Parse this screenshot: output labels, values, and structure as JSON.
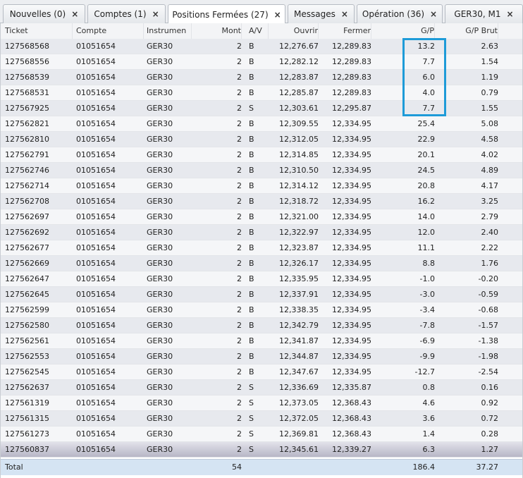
{
  "tabs": [
    {
      "label": "Nouvelles (0)",
      "active": false
    },
    {
      "label": "Comptes (1)",
      "active": false
    },
    {
      "label": "Positions Fermées (27)",
      "active": true
    },
    {
      "label": "Messages",
      "active": false
    },
    {
      "label": "Opération (36)",
      "active": false
    },
    {
      "label": "GER30, M1",
      "active": false
    }
  ],
  "close_icon": "×",
  "columns": {
    "ticket": "Ticket",
    "compte": "Compte",
    "instrument": "Instrumen",
    "mont": "Mont",
    "av": "A/V",
    "ouvrir": "Ouvrir",
    "fermer": "Fermer",
    "gp": "G/P",
    "gp_brut": "G/P Brut"
  },
  "rows": [
    [
      "127568568",
      "01051654",
      "GER30",
      "2",
      "B",
      "12,276.67",
      "12,289.83",
      "13.2",
      "2.63"
    ],
    [
      "127568556",
      "01051654",
      "GER30",
      "2",
      "B",
      "12,282.12",
      "12,289.83",
      "7.7",
      "1.54"
    ],
    [
      "127568539",
      "01051654",
      "GER30",
      "2",
      "B",
      "12,283.87",
      "12,289.83",
      "6.0",
      "1.19"
    ],
    [
      "127568531",
      "01051654",
      "GER30",
      "2",
      "B",
      "12,285.87",
      "12,289.83",
      "4.0",
      "0.79"
    ],
    [
      "127567925",
      "01051654",
      "GER30",
      "2",
      "S",
      "12,303.61",
      "12,295.87",
      "7.7",
      "1.55"
    ],
    [
      "127562821",
      "01051654",
      "GER30",
      "2",
      "B",
      "12,309.55",
      "12,334.95",
      "25.4",
      "5.08"
    ],
    [
      "127562810",
      "01051654",
      "GER30",
      "2",
      "B",
      "12,312.05",
      "12,334.95",
      "22.9",
      "4.58"
    ],
    [
      "127562791",
      "01051654",
      "GER30",
      "2",
      "B",
      "12,314.85",
      "12,334.95",
      "20.1",
      "4.02"
    ],
    [
      "127562746",
      "01051654",
      "GER30",
      "2",
      "B",
      "12,310.50",
      "12,334.95",
      "24.5",
      "4.89"
    ],
    [
      "127562714",
      "01051654",
      "GER30",
      "2",
      "B",
      "12,314.12",
      "12,334.95",
      "20.8",
      "4.17"
    ],
    [
      "127562708",
      "01051654",
      "GER30",
      "2",
      "B",
      "12,318.72",
      "12,334.95",
      "16.2",
      "3.25"
    ],
    [
      "127562697",
      "01051654",
      "GER30",
      "2",
      "B",
      "12,321.00",
      "12,334.95",
      "14.0",
      "2.79"
    ],
    [
      "127562692",
      "01051654",
      "GER30",
      "2",
      "B",
      "12,322.97",
      "12,334.95",
      "12.0",
      "2.40"
    ],
    [
      "127562677",
      "01051654",
      "GER30",
      "2",
      "B",
      "12,323.87",
      "12,334.95",
      "11.1",
      "2.22"
    ],
    [
      "127562669",
      "01051654",
      "GER30",
      "2",
      "B",
      "12,326.17",
      "12,334.95",
      "8.8",
      "1.76"
    ],
    [
      "127562647",
      "01051654",
      "GER30",
      "2",
      "B",
      "12,335.95",
      "12,334.95",
      "-1.0",
      "-0.20"
    ],
    [
      "127562645",
      "01051654",
      "GER30",
      "2",
      "B",
      "12,337.91",
      "12,334.95",
      "-3.0",
      "-0.59"
    ],
    [
      "127562599",
      "01051654",
      "GER30",
      "2",
      "B",
      "12,338.35",
      "12,334.95",
      "-3.4",
      "-0.68"
    ],
    [
      "127562580",
      "01051654",
      "GER30",
      "2",
      "B",
      "12,342.79",
      "12,334.95",
      "-7.8",
      "-1.57"
    ],
    [
      "127562561",
      "01051654",
      "GER30",
      "2",
      "B",
      "12,341.87",
      "12,334.95",
      "-6.9",
      "-1.38"
    ],
    [
      "127562553",
      "01051654",
      "GER30",
      "2",
      "B",
      "12,344.87",
      "12,334.95",
      "-9.9",
      "-1.98"
    ],
    [
      "127562545",
      "01051654",
      "GER30",
      "2",
      "B",
      "12,347.67",
      "12,334.95",
      "-12.7",
      "-2.54"
    ],
    [
      "127562637",
      "01051654",
      "GER30",
      "2",
      "S",
      "12,336.69",
      "12,335.87",
      "0.8",
      "0.16"
    ],
    [
      "127561319",
      "01051654",
      "GER30",
      "2",
      "S",
      "12,373.05",
      "12,368.43",
      "4.6",
      "0.92"
    ],
    [
      "127561315",
      "01051654",
      "GER30",
      "2",
      "S",
      "12,372.05",
      "12,368.43",
      "3.6",
      "0.72"
    ],
    [
      "127561273",
      "01051654",
      "GER30",
      "2",
      "S",
      "12,369.81",
      "12,368.43",
      "1.4",
      "0.28"
    ],
    [
      "127560837",
      "01051654",
      "GER30",
      "2",
      "S",
      "12,345.61",
      "12,339.27",
      "6.3",
      "1.27"
    ]
  ],
  "total": {
    "label": "Total",
    "mont": "54",
    "gp": "186.4",
    "gp_brut": "37.27"
  },
  "colors": {
    "highlight": "#1e9bd8",
    "total_row": "#d5e4f3"
  }
}
